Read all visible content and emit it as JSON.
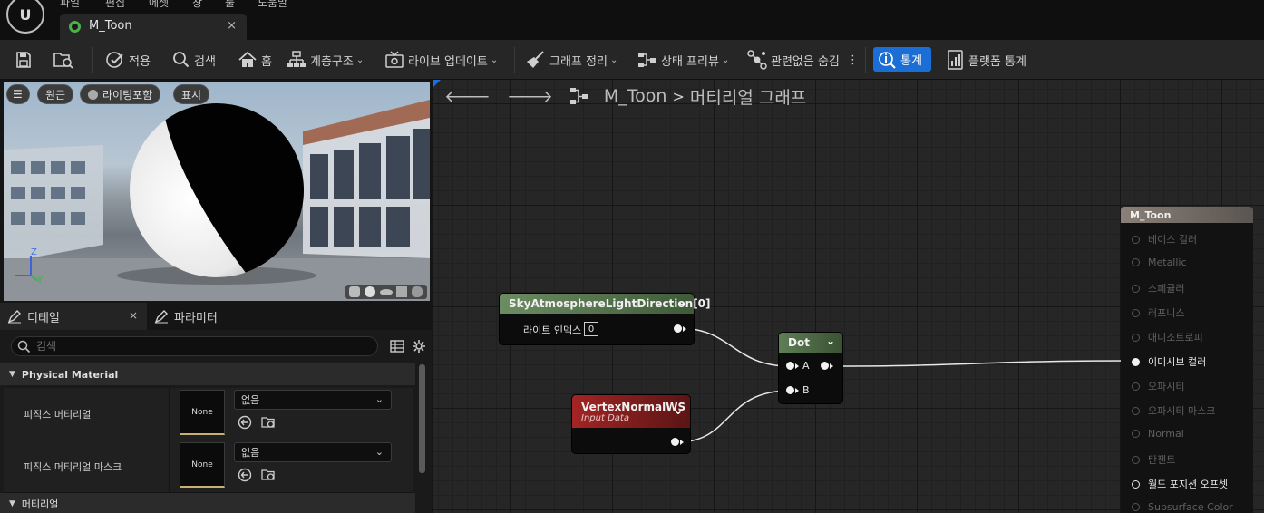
{
  "window": {
    "menu": [
      "파일",
      "편집",
      "에셋",
      "창",
      "툴",
      "도움말"
    ],
    "tab_title": "M_Toon",
    "tab_close": "×"
  },
  "toolbar": {
    "apply": "적용",
    "search": "검색",
    "home": "홈",
    "hierarchy": "계층구조",
    "live_update": "라이브 업데이트",
    "clean_graph": "그래프 정리",
    "preview_state": "상태 프리뷰",
    "hide_unrelated": "관련없음 숨김",
    "stats": "통계",
    "platform_stats": "플랫폼 통계"
  },
  "viewport": {
    "perspective": "원근",
    "lit": "라이팅포함",
    "show": "표시",
    "axis_z": "Z",
    "axis_y": "Y"
  },
  "details": {
    "tab_details": "디테일",
    "tab_params": "파라미터",
    "search_placeholder": "검색",
    "category_physical": "Physical Material",
    "category_material": "머티리얼",
    "rows": [
      {
        "label": "피직스 머티리얼",
        "thumb": "None",
        "value": "없음"
      },
      {
        "label": "피직스 머티리얼 마스크",
        "thumb": "None",
        "value": "없음"
      }
    ]
  },
  "graph": {
    "breadcrumb_asset": "M_Toon",
    "breadcrumb_sep": ">",
    "breadcrumb_graph": "머티리얼 그래프",
    "nodes": {
      "sky": {
        "title": "SkyAtmosphereLightDirection[0]",
        "label": "라이트 인덱스",
        "index": "0"
      },
      "vnormal": {
        "title": "VertexNormalWS",
        "subtitle": "Input Data"
      },
      "dot": {
        "title": "Dot",
        "pin_a": "A",
        "pin_b": "B"
      }
    },
    "result": {
      "title": "M_Toon",
      "inputs": [
        {
          "label": "베이스 컬러",
          "state": "empty"
        },
        {
          "label": "Metallic",
          "state": "empty"
        },
        {
          "label": "스페큘러",
          "state": "empty"
        },
        {
          "label": "러프니스",
          "state": "empty"
        },
        {
          "label": "애니소트로피",
          "state": "empty"
        },
        {
          "label": "이미시브 컬러",
          "state": "connected"
        },
        {
          "label": "오파시티",
          "state": "empty"
        },
        {
          "label": "오파시티 마스크",
          "state": "empty"
        },
        {
          "label": "Normal",
          "state": "empty"
        },
        {
          "label": "탄젠트",
          "state": "empty"
        },
        {
          "label": "월드 포지션 오프셋",
          "state": "available"
        },
        {
          "label": "Subsurface Color",
          "state": "empty"
        }
      ]
    }
  },
  "colors": {
    "accent": "#1b6ed6",
    "sky_header": "#5d7a54",
    "vnormal_header": "#8a1f1f",
    "dot_header": "#4d6a44"
  }
}
